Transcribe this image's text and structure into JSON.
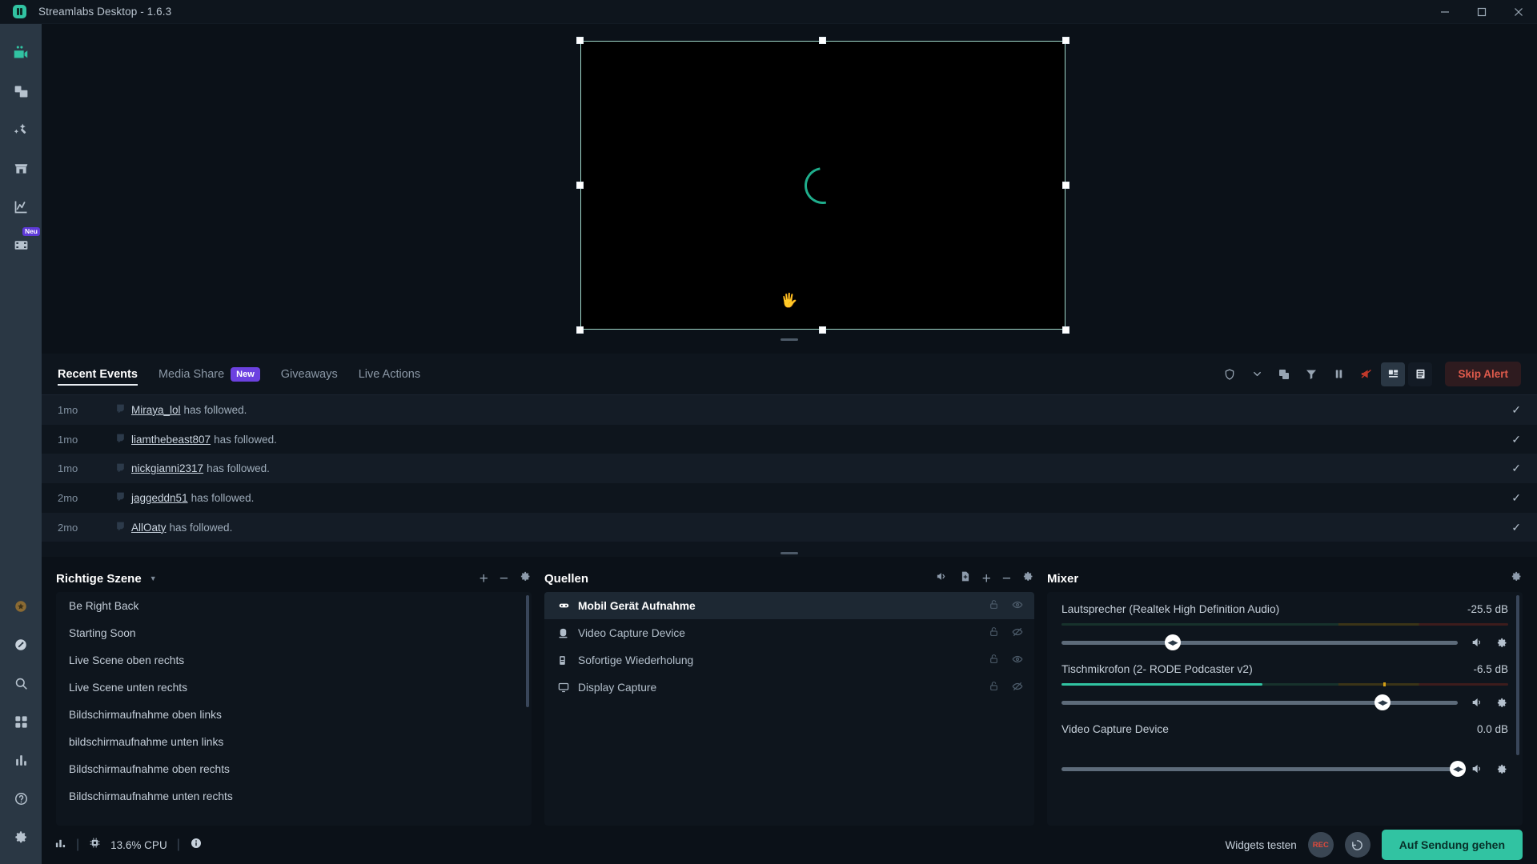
{
  "window": {
    "title": "Streamlabs Desktop - 1.6.3",
    "logo_icon": "streamlabs-logo-icon",
    "controls": [
      "minimize-icon",
      "maximize-icon",
      "close-icon"
    ]
  },
  "nav": {
    "items": [
      {
        "name": "editor",
        "icon": "video-camera-icon",
        "active": true,
        "badge": ""
      },
      {
        "name": "layout-editor",
        "icon": "layers-icon",
        "active": false,
        "badge": ""
      },
      {
        "name": "themes",
        "icon": "magic-wand-icon",
        "active": false,
        "badge": ""
      },
      {
        "name": "app-store",
        "icon": "store-icon",
        "active": false,
        "badge": ""
      },
      {
        "name": "dashboard",
        "icon": "chart-line-icon",
        "active": false,
        "badge": ""
      },
      {
        "name": "highlighter",
        "icon": "film-strip-icon",
        "active": false,
        "badge": "Neu"
      }
    ],
    "bottom_items": [
      {
        "name": "prime",
        "icon": "prime-star-icon"
      },
      {
        "name": "help-chat",
        "icon": "chat-bubble-icon"
      },
      {
        "name": "search",
        "icon": "search-icon"
      },
      {
        "name": "grid",
        "icon": "grid-icon"
      },
      {
        "name": "stats",
        "icon": "bar-chart-icon"
      },
      {
        "name": "help",
        "icon": "question-circle-icon"
      },
      {
        "name": "settings",
        "icon": "gear-icon"
      }
    ]
  },
  "preview": {
    "state_icon": "loading-spinner-icon",
    "cursor_icon": "hand-cursor-icon",
    "selection_handles": 8
  },
  "events_panel": {
    "tabs": [
      {
        "label": "Recent Events",
        "active": true,
        "badge": ""
      },
      {
        "label": "Media Share",
        "active": false,
        "badge": "New"
      },
      {
        "label": "Giveaways",
        "active": false,
        "badge": ""
      },
      {
        "label": "Live Actions",
        "active": false,
        "badge": ""
      }
    ],
    "toolbar": [
      {
        "name": "shield-icon"
      },
      {
        "name": "chevron-down-icon"
      },
      {
        "name": "copy-icon"
      },
      {
        "name": "filter-icon"
      },
      {
        "name": "pause-icon"
      },
      {
        "name": "megaphone-muted-icon"
      },
      {
        "name": "grid-view-icon"
      },
      {
        "name": "list-view-icon"
      }
    ],
    "skip_alert_label": "Skip Alert",
    "events": [
      {
        "time": "1mo",
        "platform_icon": "twitch-icon",
        "user": "Miraya_lol",
        "action": "has followed.",
        "checked": true
      },
      {
        "time": "1mo",
        "platform_icon": "twitch-icon",
        "user": "liamthebeast807",
        "action": "has followed.",
        "checked": true
      },
      {
        "time": "1mo",
        "platform_icon": "twitch-icon",
        "user": "nickgianni2317",
        "action": "has followed.",
        "checked": true
      },
      {
        "time": "2mo",
        "platform_icon": "twitch-icon",
        "user": "jaggeddn51",
        "action": "has followed.",
        "checked": true
      },
      {
        "time": "2mo",
        "platform_icon": "twitch-icon",
        "user": "AllOaty",
        "action": "has followed.",
        "checked": true
      }
    ]
  },
  "scenes_panel": {
    "title": "Richtige Szene",
    "dropdown_icon": "caret-down-icon",
    "actions": [
      {
        "name": "add-scene-icon",
        "glyph": "+"
      },
      {
        "name": "remove-scene-icon",
        "glyph": "−"
      },
      {
        "name": "scene-settings-icon",
        "glyph": "gear"
      }
    ],
    "scenes": [
      "Be Right Back",
      "Starting Soon",
      "Live Scene oben rechts",
      "Live Scene unten rechts",
      "Bildschirmaufnahme oben links",
      "bildschirmaufnahme unten links",
      "Bildschirmaufnahme oben rechts",
      "Bildschirmaufnahme unten rechts"
    ]
  },
  "sources_panel": {
    "title": "Quellen",
    "actions": [
      {
        "name": "audio-share-icon"
      },
      {
        "name": "add-file-icon"
      },
      {
        "name": "add-source-icon",
        "glyph": "+"
      },
      {
        "name": "remove-source-icon",
        "glyph": "−"
      },
      {
        "name": "source-settings-icon",
        "glyph": "gear"
      }
    ],
    "sources": [
      {
        "name": "Mobil Gerät Aufnahme",
        "icon": "mobile-device-icon",
        "selected": true,
        "locked": false,
        "visible": true
      },
      {
        "name": "Video Capture Device",
        "icon": "camera-icon",
        "selected": false,
        "locked": false,
        "visible": false
      },
      {
        "name": "Sofortige Wiederholung",
        "icon": "replay-icon",
        "selected": false,
        "locked": false,
        "visible": true
      },
      {
        "name": "Display Capture",
        "icon": "monitor-icon",
        "selected": false,
        "locked": false,
        "visible": false
      }
    ]
  },
  "mixer_panel": {
    "title": "Mixer",
    "settings_icon": "gear-icon",
    "channels": [
      {
        "name": "Lautsprecher (Realtek High Definition Audio)",
        "db": "-25.5 dB",
        "meter_level": 0,
        "volume_pct": 28,
        "mute_icon": "speaker-icon",
        "settings_icon": "gear-icon"
      },
      {
        "name": "Tischmikrofon (2- RODE Podcaster v2)",
        "db": "-6.5 dB",
        "meter_level": 45,
        "volume_pct": 81,
        "mute_icon": "speaker-icon",
        "settings_icon": "gear-icon"
      },
      {
        "name": "Video Capture Device",
        "db": "0.0 dB",
        "meter_level": 0,
        "volume_pct": 100,
        "mute_icon": "speaker-icon",
        "settings_icon": "gear-icon"
      }
    ]
  },
  "statusbar": {
    "stats_icon": "bar-chart-icon",
    "cpu_icon": "cpu-icon",
    "cpu_label": "13.6% CPU",
    "info_icon": "info-icon",
    "widgets_label": "Widgets testen",
    "rec_label": "REC",
    "replay_icon": "replay-clock-icon",
    "golive_label": "Auf Sendung gehen"
  },
  "colors": {
    "accent": "#31c3a2",
    "badge_purple": "#6c41e0",
    "alert_red": "#e05b4c",
    "nav_bg": "#2a3744",
    "app_bg": "#0b1118",
    "panel_bg": "#0e151d"
  }
}
